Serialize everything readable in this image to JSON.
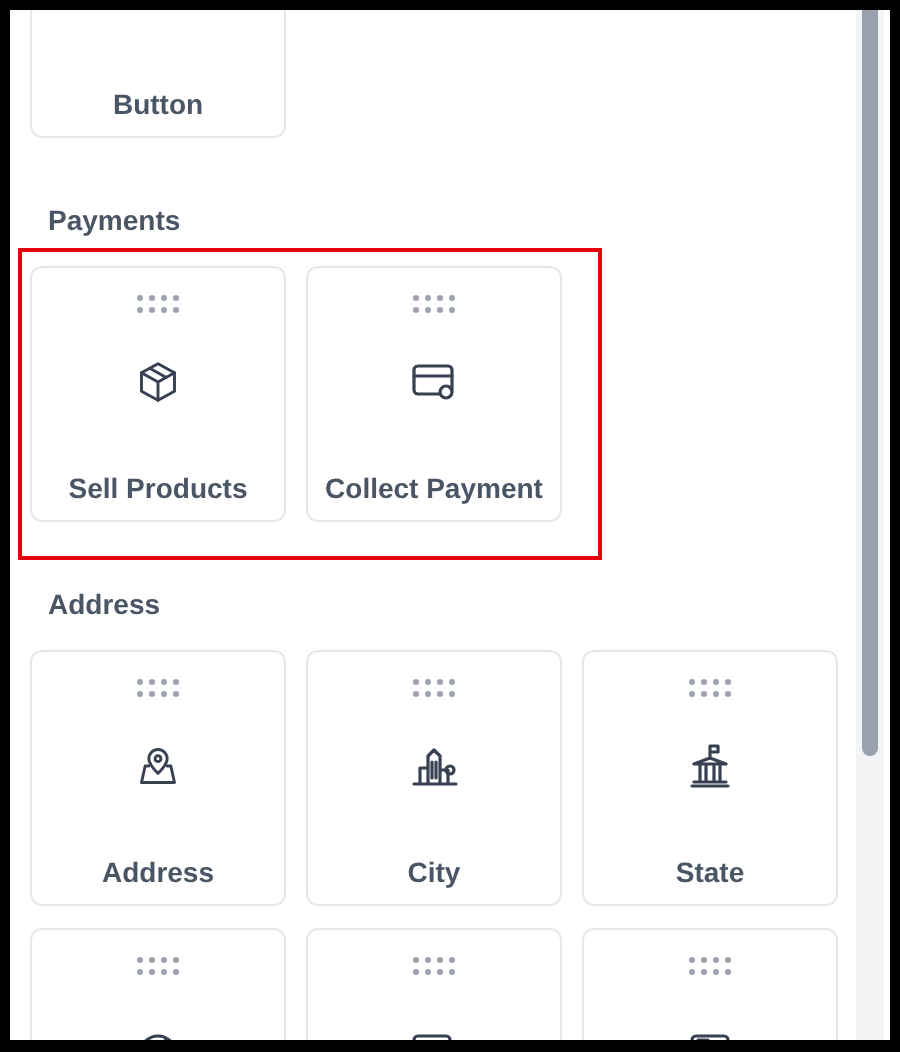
{
  "sections": [
    {
      "items": [
        {
          "kind": "card",
          "label": "Button"
        }
      ]
    },
    {
      "title": "Payments",
      "highlighted": true,
      "items": [
        {
          "kind": "card",
          "label": "Sell Products"
        },
        {
          "kind": "card",
          "label": "Collect Payment"
        }
      ]
    },
    {
      "title": "Address",
      "highlighted": false,
      "items": [
        {
          "kind": "card",
          "label": "Address"
        },
        {
          "kind": "card",
          "label": "City"
        },
        {
          "kind": "card",
          "label": "State"
        },
        {
          "kind": "cut_off"
        },
        {
          "kind": "cut_off"
        },
        {
          "kind": "cut_off"
        }
      ]
    }
  ]
}
